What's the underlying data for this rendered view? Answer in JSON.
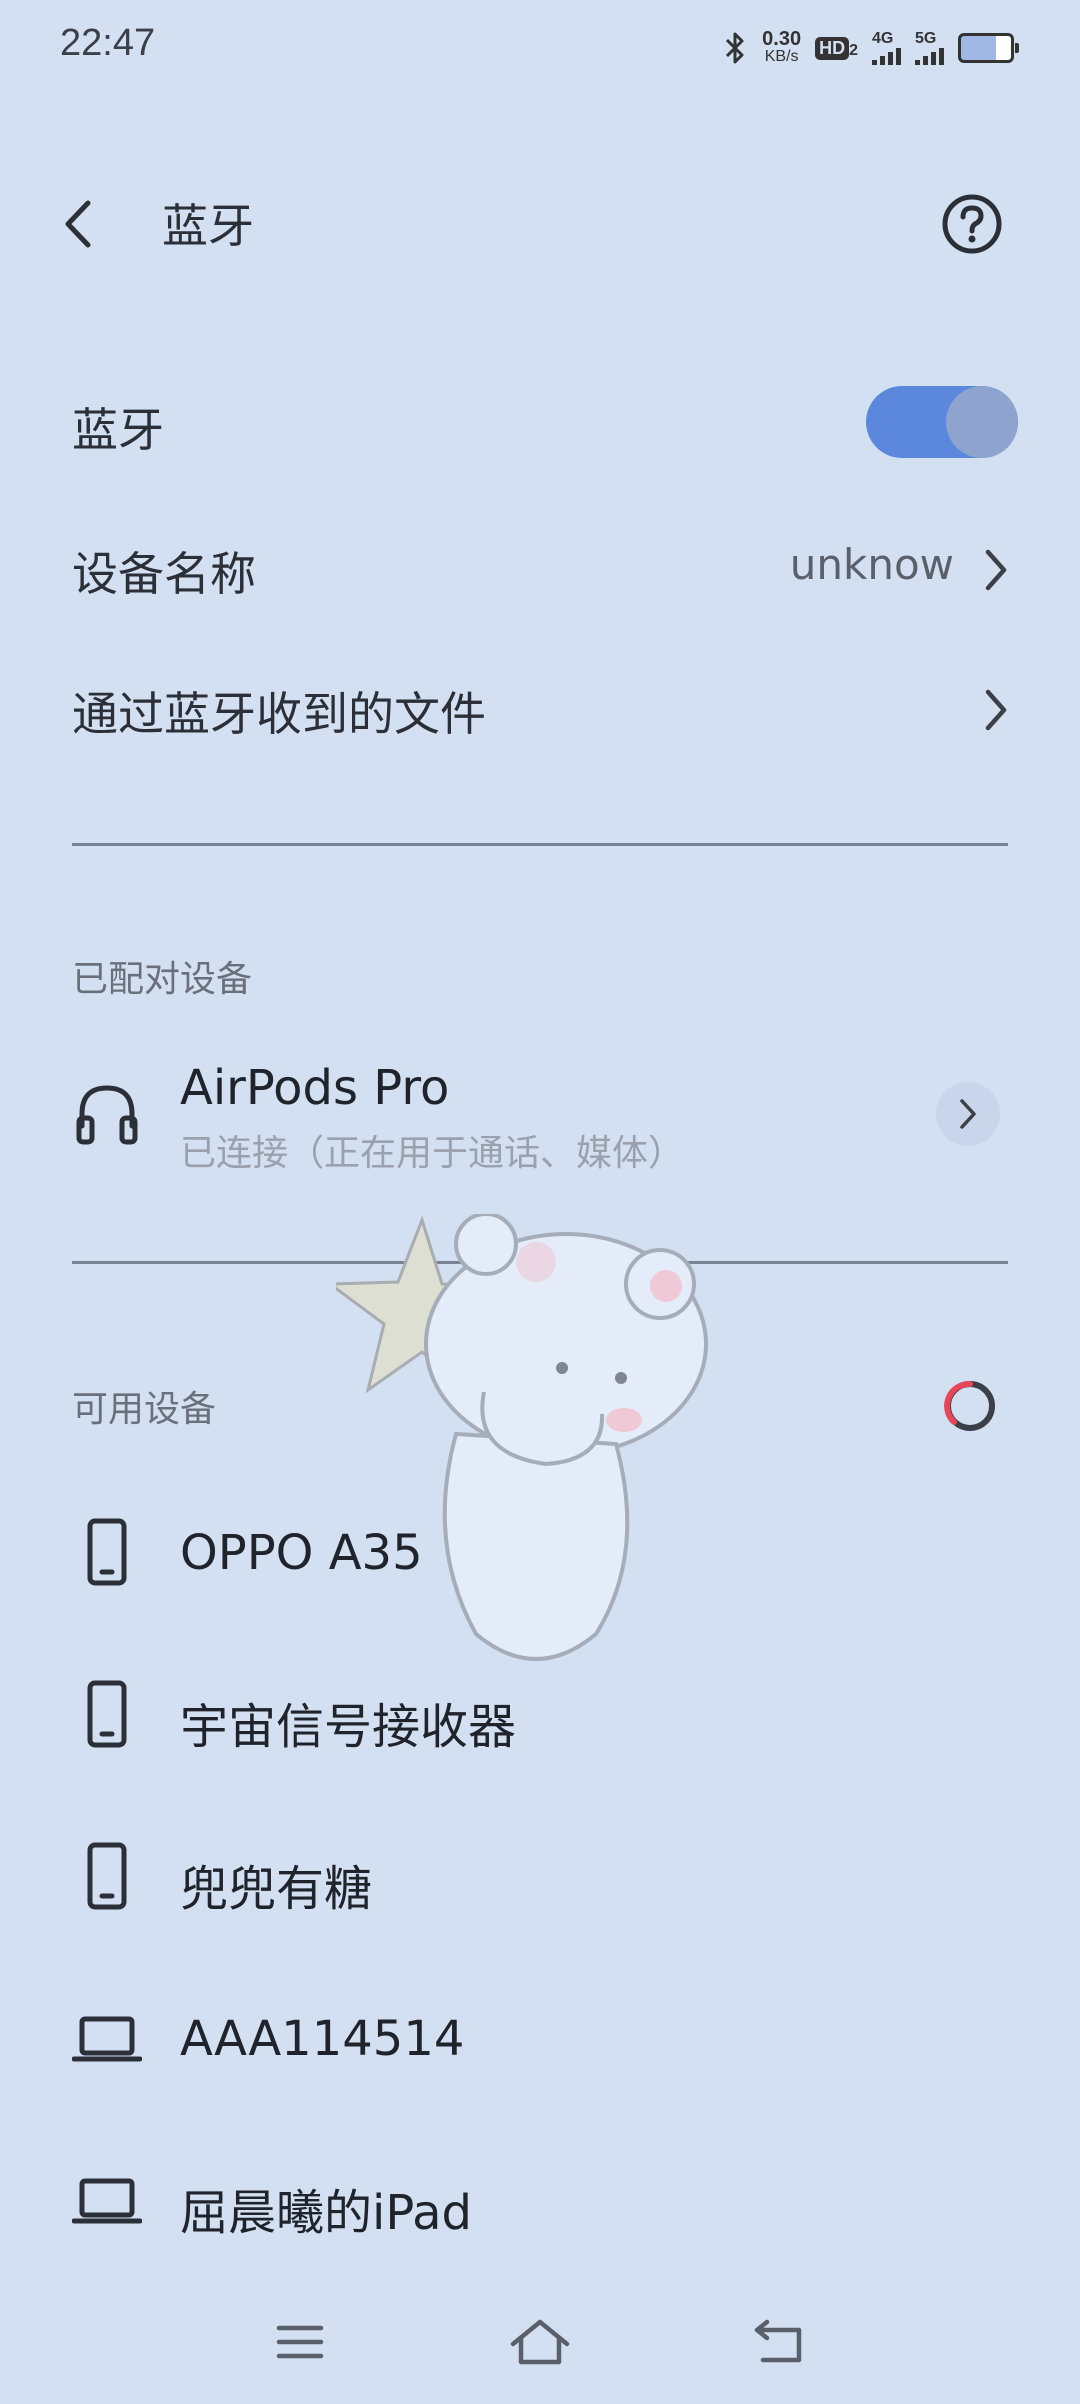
{
  "status_bar": {
    "time": "22:47",
    "speed_value": "0.30",
    "speed_unit": "KB/s",
    "hd_label": "HD",
    "hd_sub": "2",
    "sim1_label": "4G",
    "sim2_label": "5G"
  },
  "header": {
    "title": "蓝牙"
  },
  "settings": {
    "bluetooth_label": "蓝牙",
    "bluetooth_enabled": true,
    "device_name_label": "设备名称",
    "device_name_value": "unknow",
    "received_files_label": "通过蓝牙收到的文件"
  },
  "paired": {
    "section_title": "已配对设备",
    "devices": [
      {
        "name": "AirPods Pro",
        "status": "已连接（正在用于通话、媒体）",
        "icon": "headphones-icon"
      }
    ]
  },
  "available": {
    "section_title": "可用设备",
    "devices": [
      {
        "name": "OPPO A35",
        "icon": "phone-icon"
      },
      {
        "name": "宇宙信号接收器",
        "icon": "phone-icon"
      },
      {
        "name": "兜兜有糖",
        "icon": "phone-icon"
      },
      {
        "name": "AAA114514",
        "icon": "laptop-icon"
      },
      {
        "name": "屈晨曦的iPad",
        "icon": "laptop-icon"
      }
    ]
  },
  "colors": {
    "background": "#d3e0f2",
    "toggle_on": "#5b88dc",
    "spinner_accent": "#e8455a"
  }
}
